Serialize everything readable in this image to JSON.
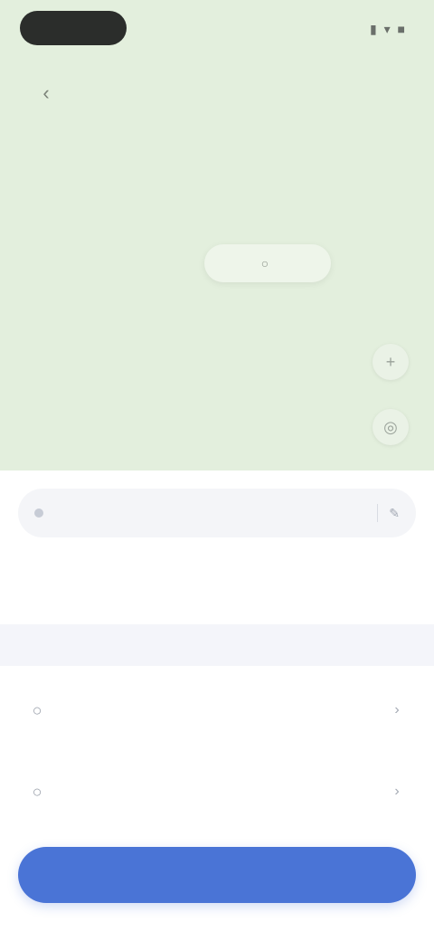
{
  "status_bar": {
    "right": "▮ ▾ ■"
  },
  "map": {
    "back_icon": "‹",
    "chip_icon": "○",
    "chip_label": "",
    "fab_1_icon": "+",
    "fab_2_icon": "◎",
    "label": "",
    "background": "#e3efdd"
  },
  "sheet": {
    "route": {
      "text": "",
      "time": "",
      "edit_icon": "✎"
    },
    "caption": "",
    "title": "",
    "section_label": "",
    "items": [
      {
        "icon": "○",
        "title": "",
        "subtitle": "",
        "trail_icon": "›"
      },
      {
        "icon": "○",
        "title": "",
        "subtitle": "",
        "trail_icon": "›"
      }
    ],
    "cta_label": ""
  },
  "colors": {
    "accent": "#4a74d6",
    "map": "#e3efdd"
  }
}
